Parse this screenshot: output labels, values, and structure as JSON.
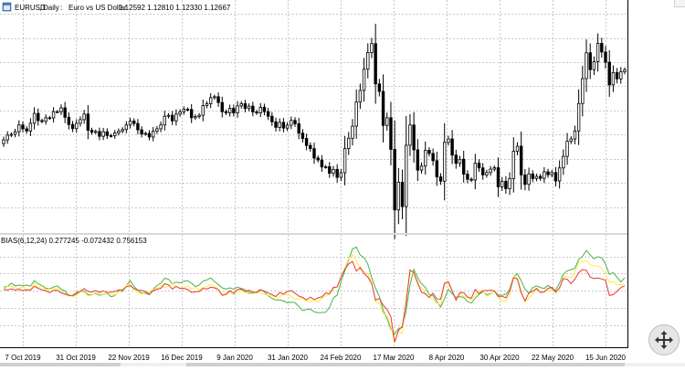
{
  "header": {
    "symbol": "EURUSD",
    "timeframe": "Daily",
    "description": "Euro vs US Dollar",
    "ohlc": "1.12592 1.12810 1.12330 1.12667"
  },
  "indicator": {
    "label": "BIAS(6,12,24) 0.277245 -0.072432 0.756153"
  },
  "colors": {
    "background": "#ffffff",
    "grid": "#c8c8c8",
    "candle": "#000000",
    "bias6": "#e53935",
    "bias12": "#ffeb3b",
    "bias24": "#4caf50"
  },
  "chart_data": [
    {
      "type": "candlestick",
      "title": "EURUSD, Daily: Euro vs US Dollar 1.12592 1.12810 1.12330 1.12667",
      "x_tick_labels": [
        "7 Oct 2019",
        "31 Oct 2019",
        "22 Nov 2019",
        "16 Dec 2019",
        "9 Jan 2020",
        "31 Jan 2020",
        "24 Feb 2020",
        "17 Mar 2020",
        "8 Apr 2020",
        "30 Apr 2020",
        "22 May 2020",
        "15 Jun 2020"
      ],
      "ylim": [
        1.06,
        1.155
      ],
      "grid": true,
      "series": [
        {
          "name": "",
          "close": [
            1.0978,
            1.0998,
            1.1001,
            1.1012,
            1.104,
            1.1024,
            1.1015,
            1.1047,
            1.1088,
            1.1058,
            1.1055,
            1.107,
            1.1069,
            1.1095,
            1.1095,
            1.1111,
            1.1072,
            1.1042,
            1.1025,
            1.1047,
            1.1062,
            1.1085,
            1.1018,
            1.101,
            1.1013,
            1.0993,
            1.1012,
            1.0996,
            1.0995,
            1.1007,
            1.1015,
            1.1021,
            1.104,
            1.1056,
            1.1046,
            1.102,
            1.1003,
            1.1005,
            1.099,
            1.1014,
            1.1024,
            1.104,
            1.1076,
            1.108,
            1.1057,
            1.1085,
            1.1094,
            1.1105,
            1.1104,
            1.107,
            1.1075,
            1.108,
            1.112,
            1.1128,
            1.1153,
            1.1157,
            1.1133,
            1.1095,
            1.109,
            1.1109,
            1.109,
            1.1119,
            1.1128,
            1.1108,
            1.1118,
            1.1094,
            1.109,
            1.1113,
            1.1095,
            1.1076,
            1.1053,
            1.103,
            1.1051,
            1.1027,
            1.1039,
            1.1059,
            1.1045,
            1.1006,
            1.0984,
            1.0955,
            1.0942,
            1.0903,
            1.0895,
            1.0866,
            1.0867,
            1.084,
            1.0856,
            1.0823,
            1.0842,
            1.0942,
            1.0985,
            1.1035,
            1.1135,
            1.1183,
            1.1271,
            1.134,
            1.1377,
            1.121,
            1.1179,
            1.1038,
            1.107,
            1.0939,
            1.0688,
            1.0803,
            1.0702,
            1.0956,
            1.104,
            1.0937,
            1.0853,
            1.087,
            1.0935,
            1.0922,
            1.0892,
            1.0825,
            1.0807,
            1.0968,
            1.0982,
            1.0915,
            1.0881,
            1.0898,
            1.0836,
            1.0815,
            1.0812,
            1.0882,
            1.0862,
            1.0833,
            1.0843,
            1.0857,
            1.0863,
            1.0784,
            1.0807,
            1.0776,
            1.0818,
            1.0931,
            1.0952,
            1.0833,
            1.0794,
            1.0837,
            1.0818,
            1.0827,
            1.0819,
            1.0846,
            1.0834,
            1.0843,
            1.0808,
            1.0862,
            1.091,
            1.0972,
            1.0982,
            1.1015,
            1.1129,
            1.1232,
            1.1339,
            1.1269,
            1.1302,
            1.1378,
            1.1342,
            1.13,
            1.1206,
            1.1257,
            1.1231,
            1.126,
            1.1268
          ]
        }
      ]
    },
    {
      "type": "line",
      "title": "BIAS(6,12,24) 0.277245 -0.072432 0.756153",
      "x_tick_labels": [],
      "ylim": [
        -3.2,
        3.2
      ],
      "grid": true,
      "series": [
        {
          "name": "",
          "color": "#e53935",
          "values": [
            0.08,
            0.03,
            0.1,
            0.03,
            0.07,
            0.0,
            0.05,
            0.03,
            0.25,
            0.13,
            0.05,
            -0.01,
            -0.12,
            0.01,
            0.02,
            -0.14,
            -0.19,
            -0.28,
            -0.29,
            -0.11,
            -0.04,
            0.11,
            -0.05,
            -0.09,
            0.0,
            -0.1,
            -0.02,
            -0.11,
            -0.09,
            -0.05,
            0.04,
            0.03,
            0.22,
            0.3,
            0.12,
            0.02,
            0.01,
            -0.06,
            -0.21,
            -0.01,
            0.08,
            0.13,
            0.4,
            0.33,
            0.09,
            0.25,
            0.12,
            0.13,
            0.07,
            -0.11,
            -0.07,
            -0.06,
            0.13,
            0.09,
            0.19,
            0.16,
            0.05,
            -0.28,
            -0.21,
            0.0,
            -0.16,
            0.07,
            0.08,
            -0.06,
            0.02,
            -0.09,
            -0.12,
            0.06,
            -0.03,
            -0.14,
            -0.23,
            -0.35,
            -0.11,
            -0.2,
            -0.06,
            0.0,
            -0.15,
            -0.32,
            -0.39,
            -0.55,
            -0.38,
            -0.53,
            -0.42,
            -0.37,
            -0.14,
            -0.19,
            0.18,
            0.22,
            0.8,
            1.25,
            1.56,
            1.7,
            1.13,
            1.35,
            1.0,
            0.79,
            0.4,
            -0.56,
            -0.46,
            -0.86,
            -1.11,
            -1.53,
            -3.0,
            -2.32,
            -2.09,
            -0.68,
            1.2,
            1.04,
            0.46,
            -0.09,
            -0.19,
            -0.41,
            -0.15,
            -0.49,
            -0.5,
            0.43,
            0.52,
            -0.02,
            -0.56,
            -0.11,
            -0.12,
            -0.38,
            -0.45,
            0.07,
            -0.18,
            0.0,
            0.0,
            0.02,
            -0.01,
            -0.34,
            -0.33,
            -0.42,
            -0.03,
            0.75,
            0.68,
            -0.15,
            -0.61,
            -0.13,
            -0.05,
            0.13,
            -0.11,
            -0.08,
            0.13,
            0.19,
            -0.1,
            0.17,
            0.7,
            0.66,
            0.4,
            0.66,
            1.04,
            1.23,
            1.18,
            0.79,
            0.71,
            0.73,
            0.68,
            0.61,
            -0.28,
            -0.24,
            -0.05,
            0.17,
            0.28
          ]
        },
        {
          "name": "",
          "color": "#ffeb3b",
          "values": [
            0.06,
            0.25,
            0.23,
            0.16,
            0.12,
            0.24,
            0.05,
            0.04,
            0.43,
            0.15,
            0.26,
            0.03,
            0.08,
            0.12,
            0.15,
            0.0,
            -0.27,
            -0.25,
            -0.36,
            -0.28,
            -0.06,
            -0.08,
            -0.3,
            -0.27,
            -0.12,
            -0.23,
            -0.21,
            -0.13,
            -0.25,
            -0.26,
            -0.08,
            0.04,
            0.28,
            0.43,
            0.03,
            -0.1,
            -0.23,
            -0.02,
            -0.08,
            0.07,
            0.11,
            0.29,
            0.17,
            0.25,
            0.42,
            0.22,
            0.16,
            0.16,
            0.26,
            0.09,
            0.19,
            0.05,
            0.2,
            0.23,
            0.36,
            0.26,
            0.07,
            -0.2,
            -0.26,
            -0.06,
            -0.24,
            -0.05,
            -0.01,
            -0.1,
            -0.18,
            -0.21,
            -0.02,
            -0.14,
            -0.2,
            -0.27,
            -0.26,
            -0.54,
            -0.35,
            -0.22,
            -0.24,
            -0.33,
            -0.51,
            -0.48,
            -0.43,
            -0.62,
            -0.65,
            -0.59,
            -0.66,
            -0.47,
            -0.3,
            -0.2,
            0.11,
            0.21,
            0.8,
            1.31,
            1.87,
            2.1,
            1.74,
            1.25,
            1.11,
            1.01,
            0.47,
            -0.66,
            -0.74,
            -1.37,
            -1.45,
            -2.1,
            -3.04,
            -2.37,
            -2.5,
            -0.4,
            0.94,
            0.97,
            0.35,
            0.18,
            -0.16,
            -0.4,
            -0.48,
            -0.73,
            -0.83,
            0.37,
            0.38,
            -0.04,
            -0.49,
            -0.17,
            -0.35,
            -0.4,
            -0.56,
            -0.27,
            0.0,
            -0.05,
            -0.33,
            -0.21,
            -0.03,
            -0.4,
            -0.61,
            -0.65,
            -0.19,
            0.82,
            0.75,
            -0.02,
            -0.65,
            -0.43,
            -0.23,
            0.06,
            -0.1,
            -0.03,
            0.0,
            0.04,
            -0.09,
            0.05,
            0.85,
            0.8,
            0.77,
            1.06,
            1.68,
            1.67,
            1.75,
            1.51,
            1.44,
            1.44,
            1.3,
            0.94,
            0.48,
            0.53,
            0.35,
            0.33,
            0.38
          ]
        },
        {
          "name": "",
          "color": "#4caf50",
          "values": [
            0.2,
            0.24,
            0.44,
            0.28,
            0.32,
            0.29,
            0.32,
            0.26,
            0.58,
            0.39,
            0.3,
            0.14,
            0.1,
            0.21,
            0.28,
            0.08,
            -0.02,
            -0.3,
            -0.3,
            -0.19,
            -0.05,
            -0.04,
            -0.23,
            -0.26,
            -0.17,
            -0.27,
            -0.22,
            -0.15,
            -0.36,
            -0.3,
            -0.03,
            -0.05,
            0.27,
            0.59,
            0.25,
            0.02,
            -0.15,
            -0.15,
            -0.24,
            0.08,
            0.29,
            0.44,
            0.72,
            0.66,
            0.39,
            0.5,
            0.45,
            0.55,
            0.58,
            0.43,
            0.24,
            0.32,
            0.55,
            0.62,
            0.74,
            0.53,
            0.35,
            0.16,
            0.09,
            0.16,
            0.09,
            0.2,
            0.13,
            0.06,
            -0.12,
            -0.12,
            -0.05,
            0.06,
            -0.07,
            -0.3,
            -0.46,
            -0.56,
            -0.54,
            -0.61,
            -0.71,
            -0.68,
            -0.7,
            -0.93,
            -1.16,
            -1.11,
            -1.08,
            -1.24,
            -1.29,
            -1.28,
            -1.27,
            -0.98,
            -0.43,
            -0.26,
            0.53,
            1.16,
            1.82,
            2.44,
            2.54,
            2.07,
            1.93,
            1.54,
            0.76,
            0.14,
            -0.35,
            -1.16,
            -1.64,
            -2.26,
            -2.54,
            -2.2,
            -2.16,
            -1.18,
            0.33,
            1.23,
            0.75,
            0.4,
            0.19,
            -0.23,
            -0.3,
            -0.64,
            -0.96,
            -0.48,
            0.07,
            -0.18,
            -0.39,
            -0.35,
            -0.4,
            -0.64,
            -0.73,
            -0.44,
            -0.22,
            -0.07,
            -0.25,
            -0.18,
            -0.04,
            -0.26,
            -0.28,
            -0.21,
            0.08,
            0.8,
            0.98,
            0.57,
            0.07,
            -0.15,
            0.17,
            0.27,
            0.18,
            0.12,
            0.31,
            0.12,
            0.02,
            0.44,
            0.96,
            1.15,
            1.22,
            1.3,
            1.82,
            2.0,
            2.34,
            2.08,
            1.85,
            1.98,
            1.91,
            1.55,
            0.94,
            1.05,
            0.78,
            0.5,
            0.76
          ]
        }
      ]
    }
  ]
}
